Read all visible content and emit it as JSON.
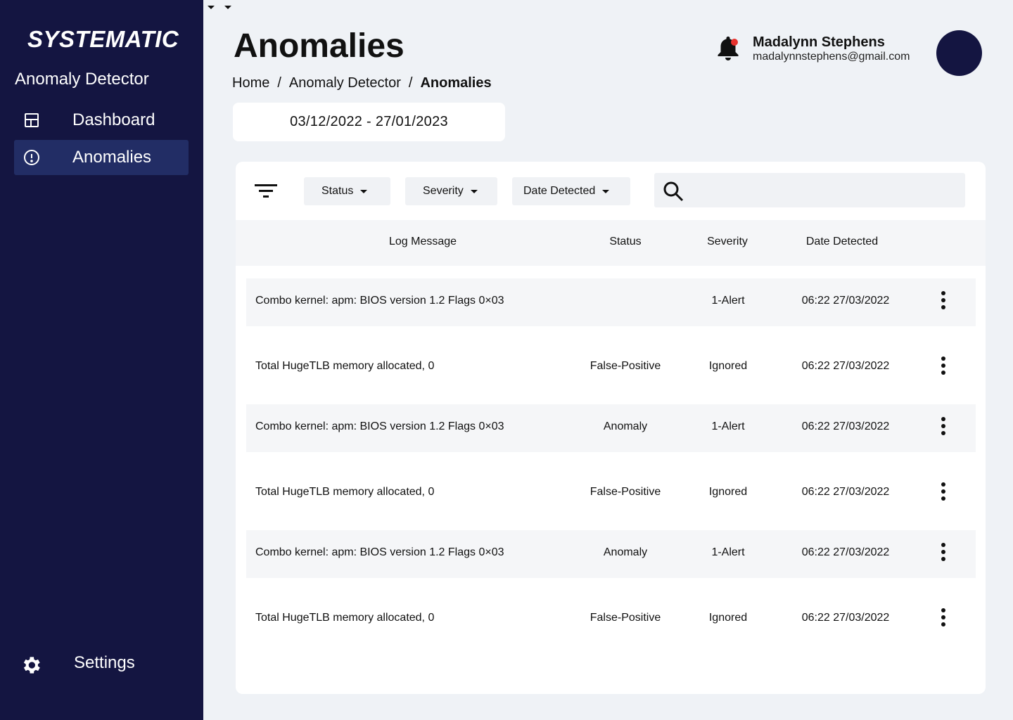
{
  "sidebar": {
    "brand": "SYSTEMATIC",
    "app_name": "Anomaly Detector",
    "items": [
      {
        "label": "Dashboard",
        "icon": "dashboard-icon",
        "active": false
      },
      {
        "label": "Anomalies",
        "icon": "alert-circle-icon",
        "active": true
      }
    ],
    "settings_label": "Settings"
  },
  "header": {
    "title": "Anomalies",
    "breadcrumb": [
      "Home",
      "Anomaly Detector",
      "Anomalies"
    ],
    "date_range": "03/12/2022 - 27/01/2023",
    "user": {
      "name": "Madalynn Stephens",
      "email": "madalynnstephens@gmail.com"
    },
    "notification_dot_color": "#e8332f"
  },
  "filters": {
    "status_label": "Status",
    "severity_label": "Severity",
    "date_label": "Date Detected",
    "search_placeholder": ""
  },
  "table": {
    "columns": [
      "Log Message",
      "Status",
      "Severity",
      "Date Detected"
    ],
    "rows": [
      {
        "message": "Combo kernel: apm: BIOS version 1.2 Flags 0×03",
        "status": "",
        "severity": "1-Alert",
        "date": "06:22 27/03/2022"
      },
      {
        "message": "Total HugeTLB memory allocated, 0",
        "status": "False-Positive",
        "severity": "Ignored",
        "date": "06:22 27/03/2022"
      },
      {
        "message": "Combo kernel: apm: BIOS version 1.2 Flags 0×03",
        "status": "Anomaly",
        "severity": "1-Alert",
        "date": "06:22 27/03/2022"
      },
      {
        "message": "Total HugeTLB memory allocated, 0",
        "status": "False-Positive",
        "severity": "Ignored",
        "date": "06:22 27/03/2022"
      },
      {
        "message": "Combo kernel: apm: BIOS version 1.2 Flags 0×03",
        "status": "Anomaly",
        "severity": "1-Alert",
        "date": "06:22 27/03/2022"
      },
      {
        "message": "Total HugeTLB memory allocated, 0",
        "status": "False-Positive",
        "severity": "Ignored",
        "date": "06:22 27/03/2022"
      }
    ]
  },
  "colors": {
    "sidebar_bg": "#141541",
    "active_item_bg": "#222d65",
    "page_bg": "#eff2f6"
  }
}
